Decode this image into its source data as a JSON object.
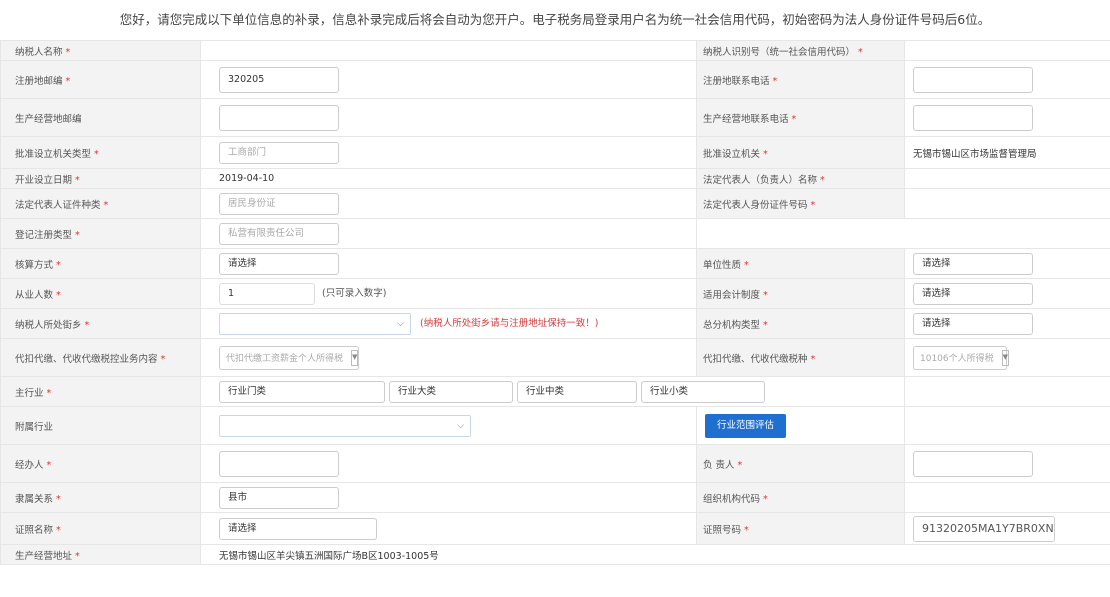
{
  "notice": "您好，请您完成以下单位信息的补录，信息补录完成后将会自动为您开户。电子税务局登录用户名为统一社会信用代码，初始密码为法人身份证件号码后6位。",
  "rows": {
    "r1": {
      "l1": "纳税人名称",
      "v1": "",
      "l2": "纳税人识别号（统一社会信用代码）",
      "v2": ""
    },
    "r2": {
      "l1": "注册地邮编",
      "v1": "320205",
      "l2": "注册地联系电话",
      "v2": ""
    },
    "r3": {
      "l1": "生产经营地邮编",
      "v1": "",
      "l2": "生产经营地联系电话",
      "v2": ""
    },
    "r4": {
      "l1": "批准设立机关类型",
      "v1": "工商部门",
      "l2": "批准设立机关",
      "v2": "无锡市锡山区市场监督管理局"
    },
    "r5": {
      "l1": "开业设立日期",
      "v1": "2019-04-10",
      "l2": "法定代表人（负责人）名称",
      "v2": ""
    },
    "r6": {
      "l1": "法定代表人证件种类",
      "v1": "居民身份证",
      "l2": "法定代表人身份证件号码",
      "v2": ""
    },
    "r7": {
      "l1": "登记注册类型",
      "v1": "私营有限责任公司"
    },
    "r8": {
      "l1": "核算方式",
      "v1": "请选择",
      "l2": "单位性质",
      "v2": "请选择"
    },
    "r9": {
      "l1": "从业人数",
      "v1": "1",
      "hint": "(只可录入数字)",
      "l2": "适用会计制度",
      "v2": "请选择"
    },
    "r10": {
      "l1": "纳税人所处街乡",
      "v1": "",
      "hint": "(纳税人所处街乡请与注册地址保持一致！)",
      "l2": "总分机构类型",
      "v2": "请选择"
    },
    "r11": {
      "l1": "代扣代缴、代收代缴税控业务内容",
      "v1": "代扣代缴工资薪金个人所得税",
      "l2": "代扣代缴、代收代缴税种",
      "v2": "10106个人所得税"
    },
    "r12": {
      "l1": "主行业",
      "men": "行业门类",
      "da": "行业大类",
      "zhong": "行业中类",
      "xiao": "行业小类"
    },
    "r13": {
      "l1": "附属行业",
      "v1": "",
      "btn": "行业范围评估"
    },
    "r14": {
      "l1": "经办人",
      "v1": "",
      "l2": "负 责人",
      "v2": ""
    },
    "r15": {
      "l1": "隶属关系",
      "v1": "县市",
      "l2": "组织机构代码",
      "v2": ""
    },
    "r16": {
      "l1": "证照名称",
      "v1": "请选择",
      "l2": "证照号码",
      "v2": "91320205MA1Y7BR0XN"
    },
    "r17": {
      "l1": "生产经营地址",
      "v1": "无锡市锡山区羊尖镇五洲国际广场B区1003-1005号"
    }
  },
  "icons": {
    "chevron": "chevron-down-icon"
  }
}
